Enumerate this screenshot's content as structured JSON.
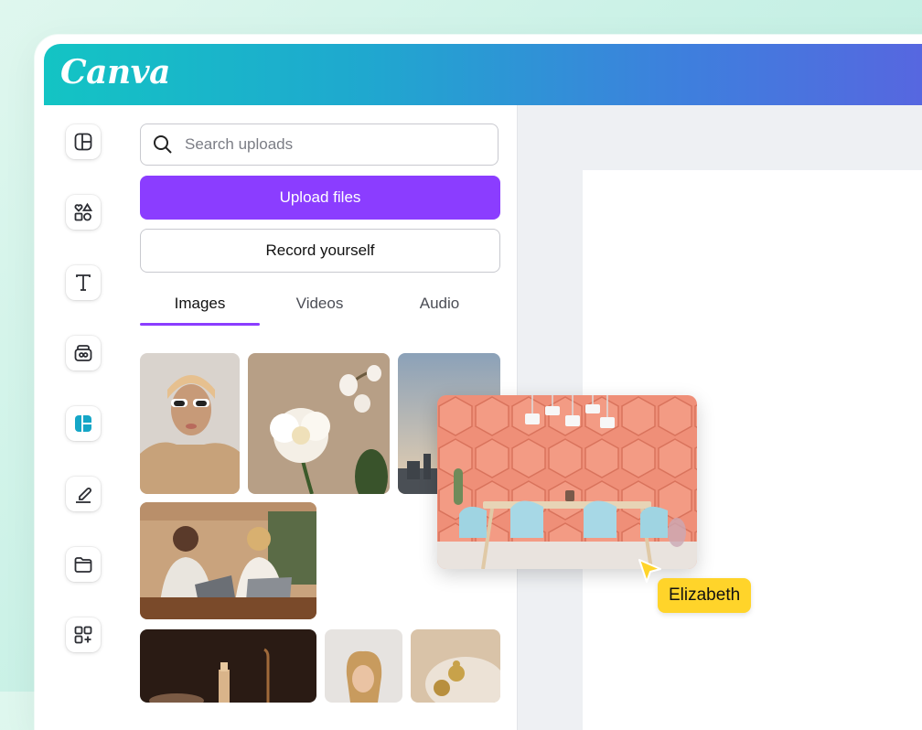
{
  "app": {
    "logo_text": "Canva",
    "accent_color": "#8b3dff"
  },
  "sidebar": {
    "items": [
      {
        "icon": "layout-icon"
      },
      {
        "icon": "elements-icon"
      },
      {
        "icon": "text-icon"
      },
      {
        "icon": "brand-icon"
      },
      {
        "icon": "uploads-icon",
        "active": true
      },
      {
        "icon": "draw-icon"
      },
      {
        "icon": "folder-icon"
      },
      {
        "icon": "apps-icon"
      }
    ]
  },
  "panel": {
    "search": {
      "placeholder": "Search uploads"
    },
    "upload_button": "Upload files",
    "record_button": "Record yourself",
    "tabs": [
      {
        "label": "Images",
        "active": true
      },
      {
        "label": "Videos"
      },
      {
        "label": "Audio"
      }
    ]
  },
  "canvas": {
    "collaborator": {
      "name": "Elizabeth",
      "color": "#ffd42a"
    }
  }
}
